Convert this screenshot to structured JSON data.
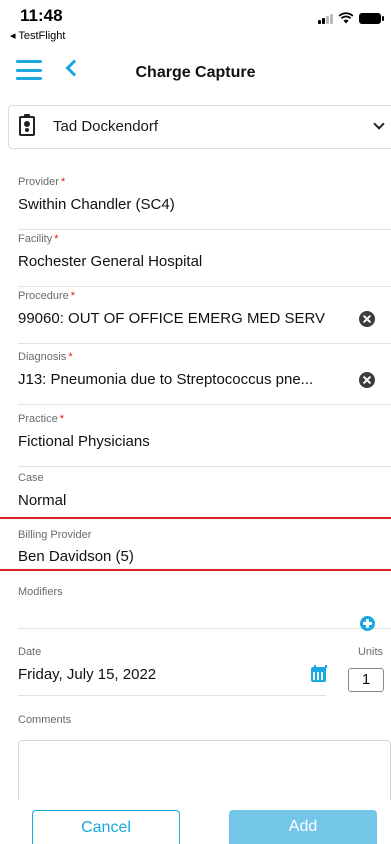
{
  "status_bar": {
    "time": "11:48",
    "back_app": "◂ TestFlight"
  },
  "nav": {
    "title": "Charge Capture"
  },
  "patient": {
    "name": "Tad Dockendorf"
  },
  "fields": {
    "provider": {
      "label": "Provider",
      "value": "Swithin Chandler (SC4)",
      "required": true
    },
    "facility": {
      "label": "Facility",
      "value": "Rochester General Hospital",
      "required": true
    },
    "procedure": {
      "label": "Procedure",
      "value": "99060: OUT OF OFFICE EMERG MED SERV",
      "required": true
    },
    "diagnosis": {
      "label": "Diagnosis",
      "value": "J13: Pneumonia due to Streptococcus pne...",
      "required": true
    },
    "practice": {
      "label": "Practice",
      "value": "Fictional Physicians",
      "required": true
    },
    "case": {
      "label": "Case",
      "value": "Normal"
    },
    "billing_provider": {
      "label": "Billing Provider",
      "value": "Ben Davidson (5)"
    },
    "modifiers": {
      "label": "Modifiers",
      "value": ""
    },
    "date": {
      "label": "Date",
      "value": "Friday, July 15, 2022"
    },
    "units": {
      "label": "Units",
      "value": "1"
    },
    "comments": {
      "label": "Comments",
      "value": ""
    }
  },
  "required_mark": "*",
  "buttons": {
    "cancel": "Cancel",
    "add": "Add"
  },
  "icons": {
    "menu": "hamburger-menu-icon",
    "back": "chevron-left-icon",
    "patient": "clipboard-id-icon",
    "dropdown": "chevron-down-icon",
    "clear": "clear-circle-x-icon",
    "add_modifier": "plus-circle-icon",
    "calendar": "calendar-icon"
  },
  "colors": {
    "accent": "#1ba8e0",
    "required": "#e0201b",
    "highlight_border": "#d9262b",
    "add_button_bg": "#74c6e9"
  }
}
